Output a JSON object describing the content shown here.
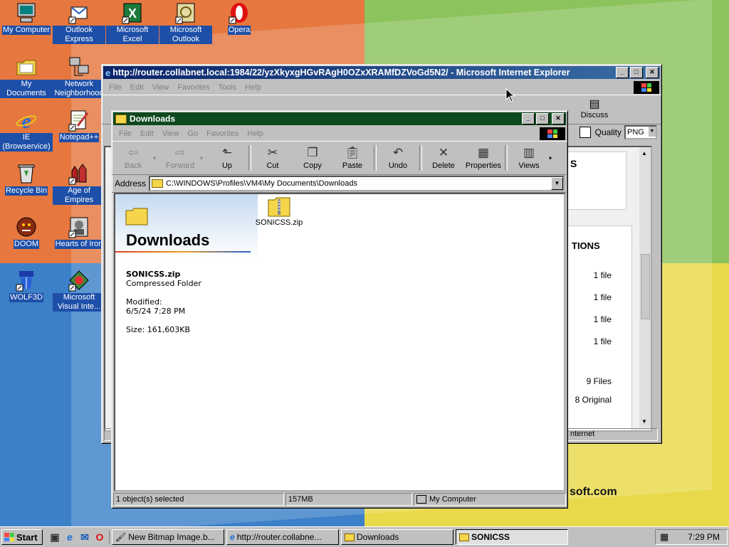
{
  "desktop": {
    "icons": [
      {
        "label": "My Computer"
      },
      {
        "label": "Outlook Express"
      },
      {
        "label": "Microsoft Excel"
      },
      {
        "label": "Microsoft Outlook"
      },
      {
        "label": "Opera"
      },
      {
        "label": "My Documents"
      },
      {
        "label": "Network Neighborhood"
      },
      {
        "label": "IE (Browservice)"
      },
      {
        "label": "Notepad++"
      },
      {
        "label": "Recycle Bin"
      },
      {
        "label": "Age of Empires"
      },
      {
        "label": "DOOM"
      },
      {
        "label": "Hearts of Iron"
      },
      {
        "label": "WOLF3D"
      },
      {
        "label": "Microsoft Visual Inte..."
      }
    ]
  },
  "ie_window": {
    "title": "http://router.collabnet.local:1984/22/yzXkyxgHGvRAgH0OZxXRAMfDZVoGd5N2/ - Microsoft Internet Explorer",
    "menus": [
      "File",
      "Edit",
      "View",
      "Favorites",
      "Tools",
      "Help"
    ],
    "toolbar_visible_label": "Discuss",
    "quality_label": "Quality",
    "quality_value": "PNG",
    "page_heading_fragment": "S",
    "section_heading_fragment": "TIONS",
    "file_counts": [
      "1 file",
      "1 file",
      "1 file",
      "1 file"
    ],
    "total_files": "9 Files",
    "original_fragment": "8 Original",
    "footer_fragment": "soft.com",
    "status_zone": "nternet"
  },
  "downloads_window": {
    "title": "Downloads",
    "menus": [
      "File",
      "Edit",
      "View",
      "Go",
      "Favorites",
      "Help"
    ],
    "toolbar": {
      "back": "Back",
      "forward": "Forward",
      "up": "Up",
      "cut": "Cut",
      "copy": "Copy",
      "paste": "Paste",
      "undo": "Undo",
      "delete": "Delete",
      "properties": "Properties",
      "views": "Views"
    },
    "address_label": "Address",
    "address_value": "C:\\WINDOWS\\Profiles\\VM4\\My Documents\\Downloads",
    "folder_heading": "Downloads",
    "selected_name": "SONICSS.zip",
    "selected_type": "Compressed Folder",
    "modified_label": "Modified:",
    "modified_value": "6/5/24 7:28 PM",
    "size_text": "Size: 161,603KB",
    "file_item": "SONICSS.zip",
    "status": {
      "selected": "1 object(s) selected",
      "size": "157MB",
      "location": "My Computer"
    }
  },
  "taskbar": {
    "start": "Start",
    "tasks": [
      "New Bitmap Image.b...",
      "http://router.collabne...",
      "Downloads",
      "SONICSS"
    ],
    "clock": "7:29 PM"
  },
  "colors": {
    "title_active": "#000080",
    "face": "#c0c0c0"
  }
}
